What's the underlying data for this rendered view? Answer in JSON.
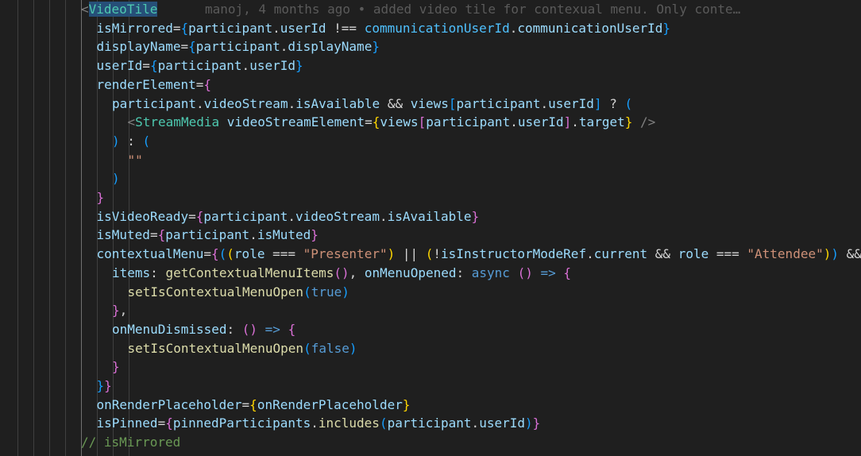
{
  "editor": {
    "blame": "manoj, 4 months ago • added video tile for contexual menu. Only conte…",
    "lines": [
      {
        "indent": 0,
        "tokens": [
          [
            "t-punc",
            "<"
          ],
          [
            "t-tag t-sel",
            "VideoTile"
          ]
        ],
        "blame": true
      },
      {
        "indent": 1,
        "tokens": [
          [
            "t-attr",
            "isMirrored"
          ],
          [
            "t-op",
            "="
          ],
          [
            "t-brace3",
            "{"
          ],
          [
            "t-var",
            "participant"
          ],
          [
            "t-op",
            "."
          ],
          [
            "t-var",
            "userId"
          ],
          [
            "t-op",
            " !== "
          ],
          [
            "t-const",
            "communicationUserId"
          ],
          [
            "t-op",
            "."
          ],
          [
            "t-var",
            "communicationUserId"
          ],
          [
            "t-brace3",
            "}"
          ]
        ]
      },
      {
        "indent": 1,
        "tokens": [
          [
            "t-attr",
            "displayName"
          ],
          [
            "t-op",
            "="
          ],
          [
            "t-brace3",
            "{"
          ],
          [
            "t-var",
            "participant"
          ],
          [
            "t-op",
            "."
          ],
          [
            "t-var",
            "displayName"
          ],
          [
            "t-brace3",
            "}"
          ]
        ]
      },
      {
        "indent": 1,
        "tokens": [
          [
            "t-attr",
            "userId"
          ],
          [
            "t-op",
            "="
          ],
          [
            "t-brace3",
            "{"
          ],
          [
            "t-var",
            "participant"
          ],
          [
            "t-op",
            "."
          ],
          [
            "t-var",
            "userId"
          ],
          [
            "t-brace3",
            "}"
          ]
        ]
      },
      {
        "indent": 1,
        "tokens": [
          [
            "t-attr",
            "renderElement"
          ],
          [
            "t-op",
            "="
          ],
          [
            "t-brace2",
            "{"
          ]
        ]
      },
      {
        "indent": 2,
        "tokens": [
          [
            "t-var",
            "participant"
          ],
          [
            "t-op",
            "."
          ],
          [
            "t-var",
            "videoStream"
          ],
          [
            "t-op",
            "."
          ],
          [
            "t-var",
            "isAvailable"
          ],
          [
            "t-op",
            " && "
          ],
          [
            "t-var",
            "views"
          ],
          [
            "t-brace3",
            "["
          ],
          [
            "t-var",
            "participant"
          ],
          [
            "t-op",
            "."
          ],
          [
            "t-var",
            "userId"
          ],
          [
            "t-brace3",
            "]"
          ],
          [
            "t-op",
            " ? "
          ],
          [
            "t-brace3",
            "("
          ]
        ]
      },
      {
        "indent": 3,
        "tokens": [
          [
            "t-punc",
            "<"
          ],
          [
            "t-tag",
            "StreamMedia"
          ],
          [
            "t-op",
            " "
          ],
          [
            "t-attr",
            "videoStreamElement"
          ],
          [
            "t-op",
            "="
          ],
          [
            "t-brace1",
            "{"
          ],
          [
            "t-var",
            "views"
          ],
          [
            "t-brace2",
            "["
          ],
          [
            "t-var",
            "participant"
          ],
          [
            "t-op",
            "."
          ],
          [
            "t-var",
            "userId"
          ],
          [
            "t-brace2",
            "]"
          ],
          [
            "t-op",
            "."
          ],
          [
            "t-var",
            "target"
          ],
          [
            "t-brace1",
            "}"
          ],
          [
            "t-punc",
            " />"
          ]
        ]
      },
      {
        "indent": 2,
        "tokens": [
          [
            "t-brace3",
            ")"
          ],
          [
            "t-op",
            " : "
          ],
          [
            "t-brace3",
            "("
          ]
        ]
      },
      {
        "indent": 3,
        "tokens": [
          [
            "t-str",
            "\"\""
          ]
        ]
      },
      {
        "indent": 2,
        "tokens": [
          [
            "t-brace3",
            ")"
          ]
        ]
      },
      {
        "indent": 1,
        "tokens": [
          [
            "t-brace2",
            "}"
          ]
        ]
      },
      {
        "indent": 1,
        "tokens": [
          [
            "t-attr",
            "isVideoReady"
          ],
          [
            "t-op",
            "="
          ],
          [
            "t-brace2",
            "{"
          ],
          [
            "t-var",
            "participant"
          ],
          [
            "t-op",
            "."
          ],
          [
            "t-var",
            "videoStream"
          ],
          [
            "t-op",
            "."
          ],
          [
            "t-var",
            "isAvailable"
          ],
          [
            "t-brace2",
            "}"
          ]
        ]
      },
      {
        "indent": 1,
        "tokens": [
          [
            "t-attr",
            "isMuted"
          ],
          [
            "t-op",
            "="
          ],
          [
            "t-brace2",
            "{"
          ],
          [
            "t-var",
            "participant"
          ],
          [
            "t-op",
            "."
          ],
          [
            "t-var",
            "isMuted"
          ],
          [
            "t-brace2",
            "}"
          ]
        ]
      },
      {
        "indent": 1,
        "tokens": [
          [
            "t-attr",
            "contextualMenu"
          ],
          [
            "t-op",
            "="
          ],
          [
            "t-brace2",
            "{"
          ],
          [
            "t-brace3",
            "("
          ],
          [
            "t-brace1",
            "("
          ],
          [
            "t-var",
            "role"
          ],
          [
            "t-op",
            " === "
          ],
          [
            "t-str",
            "\"Presenter\""
          ],
          [
            "t-brace1",
            ")"
          ],
          [
            "t-op",
            " || "
          ],
          [
            "t-brace1",
            "("
          ],
          [
            "t-op",
            "!"
          ],
          [
            "t-var",
            "isInstructorModeRef"
          ],
          [
            "t-op",
            "."
          ],
          [
            "t-var",
            "current"
          ],
          [
            "t-op",
            " && "
          ],
          [
            "t-var",
            "role"
          ],
          [
            "t-op",
            " === "
          ],
          [
            "t-str",
            "\"Attendee\""
          ],
          [
            "t-brace1",
            ")"
          ],
          [
            "t-brace3",
            ")"
          ],
          [
            "t-op",
            " &&"
          ]
        ]
      },
      {
        "indent": 2,
        "tokens": [
          [
            "t-var",
            "items"
          ],
          [
            "t-op",
            ": "
          ],
          [
            "t-fn",
            "getContextualMenuItems"
          ],
          [
            "t-brace2",
            "()"
          ],
          [
            "t-op",
            ", "
          ],
          [
            "t-var",
            "onMenuOpened"
          ],
          [
            "t-op",
            ": "
          ],
          [
            "t-kw",
            "async"
          ],
          [
            "t-op",
            " "
          ],
          [
            "t-brace2",
            "()"
          ],
          [
            "t-op",
            " "
          ],
          [
            "t-kw",
            "=>"
          ],
          [
            "t-op",
            " "
          ],
          [
            "t-brace2",
            "{"
          ]
        ]
      },
      {
        "indent": 3,
        "tokens": [
          [
            "t-fn",
            "setIsContextualMenuOpen"
          ],
          [
            "t-brace3",
            "("
          ],
          [
            "t-kw",
            "true"
          ],
          [
            "t-brace3",
            ")"
          ]
        ]
      },
      {
        "indent": 2,
        "tokens": [
          [
            "t-brace2",
            "}"
          ],
          [
            "t-op",
            ","
          ]
        ]
      },
      {
        "indent": 2,
        "tokens": [
          [
            "t-var",
            "onMenuDismissed"
          ],
          [
            "t-op",
            ": "
          ],
          [
            "t-brace2",
            "()"
          ],
          [
            "t-op",
            " "
          ],
          [
            "t-kw",
            "=>"
          ],
          [
            "t-op",
            " "
          ],
          [
            "t-brace2",
            "{"
          ]
        ]
      },
      {
        "indent": 3,
        "tokens": [
          [
            "t-fn",
            "setIsContextualMenuOpen"
          ],
          [
            "t-brace3",
            "("
          ],
          [
            "t-kw",
            "false"
          ],
          [
            "t-brace3",
            ")"
          ]
        ]
      },
      {
        "indent": 2,
        "tokens": [
          [
            "t-brace2",
            "}"
          ]
        ]
      },
      {
        "indent": 1,
        "tokens": [
          [
            "t-brace3",
            "}"
          ],
          [
            "t-brace2",
            "}"
          ]
        ]
      },
      {
        "indent": 1,
        "tokens": [
          [
            "t-attr",
            "onRenderPlaceholder"
          ],
          [
            "t-op",
            "="
          ],
          [
            "t-brace1",
            "{"
          ],
          [
            "t-var",
            "onRenderPlaceholder"
          ],
          [
            "t-brace1",
            "}"
          ]
        ]
      },
      {
        "indent": 1,
        "tokens": [
          [
            "t-attr",
            "isPinned"
          ],
          [
            "t-op",
            "="
          ],
          [
            "t-brace2",
            "{"
          ],
          [
            "t-var",
            "pinnedParticipants"
          ],
          [
            "t-op",
            "."
          ],
          [
            "t-fn",
            "includes"
          ],
          [
            "t-brace3",
            "("
          ],
          [
            "t-var",
            "participant"
          ],
          [
            "t-op",
            "."
          ],
          [
            "t-var",
            "userId"
          ],
          [
            "t-brace3",
            ")"
          ],
          [
            "t-brace2",
            "}"
          ]
        ]
      },
      {
        "indent": 0,
        "tokens": [
          [
            "t-cmt",
            "// isMirrored"
          ]
        ]
      }
    ]
  }
}
